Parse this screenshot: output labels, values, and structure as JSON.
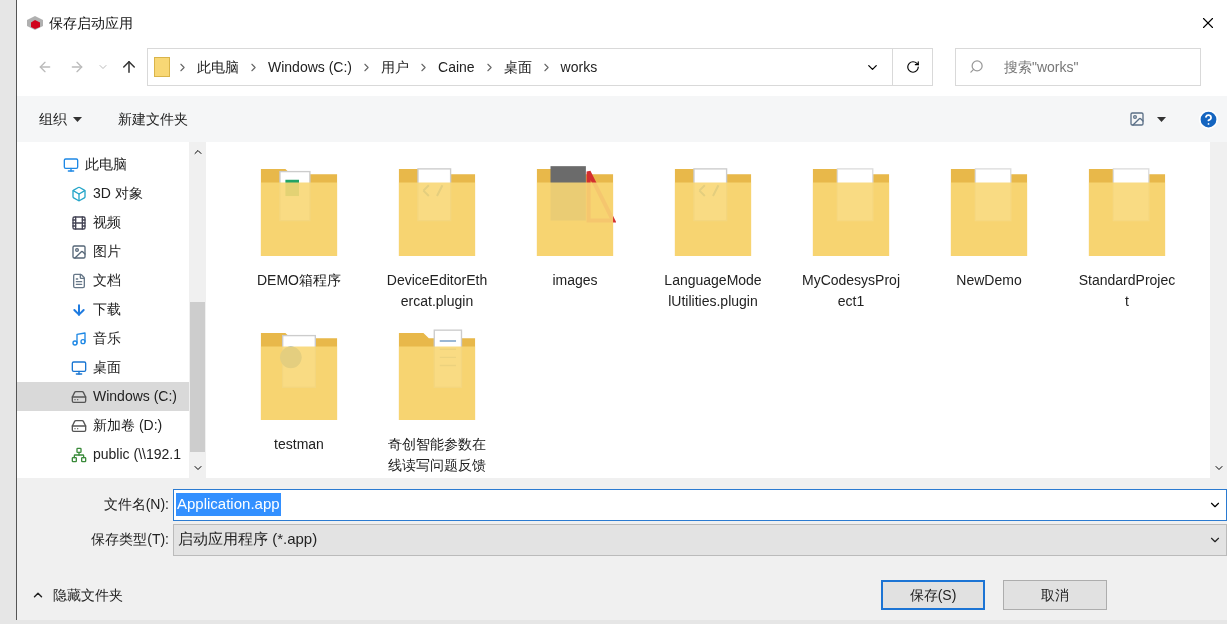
{
  "window": {
    "title": "保存启动应用"
  },
  "address": {
    "crumbs": [
      "此电脑",
      "Windows (C:)",
      "用户",
      "Caine",
      "桌面",
      "works"
    ]
  },
  "search": {
    "placeholder": "搜索\"works\""
  },
  "toolbar": {
    "organize": "组织",
    "new_folder": "新建文件夹"
  },
  "sidebar": {
    "items": [
      {
        "label": "此电脑",
        "kind": "monitor",
        "selected": false,
        "children": [
          {
            "label": "3D 对象",
            "kind": "cube",
            "selected": false
          },
          {
            "label": "视频",
            "kind": "film",
            "selected": false
          },
          {
            "label": "图片",
            "kind": "picture",
            "selected": false
          },
          {
            "label": "文档",
            "kind": "document",
            "selected": false
          },
          {
            "label": "下载",
            "kind": "download",
            "selected": false
          },
          {
            "label": "音乐",
            "kind": "music",
            "selected": false
          },
          {
            "label": "桌面",
            "kind": "desktop",
            "selected": false
          },
          {
            "label": "Windows (C:)",
            "kind": "drive",
            "selected": true
          },
          {
            "label": "新加卷 (D:)",
            "kind": "drive",
            "selected": false
          },
          {
            "label": "public (\\\\192.1",
            "kind": "network",
            "selected": false
          }
        ]
      }
    ]
  },
  "files": [
    {
      "lines": [
        "DEMO箱程序"
      ],
      "kind": "sheet"
    },
    {
      "lines": [
        "DeviceEditorEth",
        "ercat.plugin"
      ],
      "kind": "code"
    },
    {
      "lines": [
        "images"
      ],
      "kind": "photo"
    },
    {
      "lines": [
        "LanguageMode",
        "lUtilities.plugin"
      ],
      "kind": "code"
    },
    {
      "lines": [
        "MyCodesysProj",
        "ect1"
      ],
      "kind": "plain"
    },
    {
      "lines": [
        "NewDemo"
      ],
      "kind": "plain"
    },
    {
      "lines": [
        "StandardProjec",
        "t"
      ],
      "kind": "plain"
    },
    {
      "lines": [
        "testman"
      ],
      "kind": "web"
    },
    {
      "lines": [
        "奇创智能参数在",
        "线读写问题反馈"
      ],
      "kind": "document"
    }
  ],
  "filename": {
    "label": "文件名(N):",
    "value": "Application.app"
  },
  "filetype": {
    "label": "保存类型(T):",
    "value": "启动应用程序 (*.app)"
  },
  "hide_folders": "隐藏文件夹",
  "buttons": [
    {
      "label": "保存(S)",
      "kind": "primary"
    },
    {
      "label": "取消",
      "kind": "normal"
    }
  ]
}
